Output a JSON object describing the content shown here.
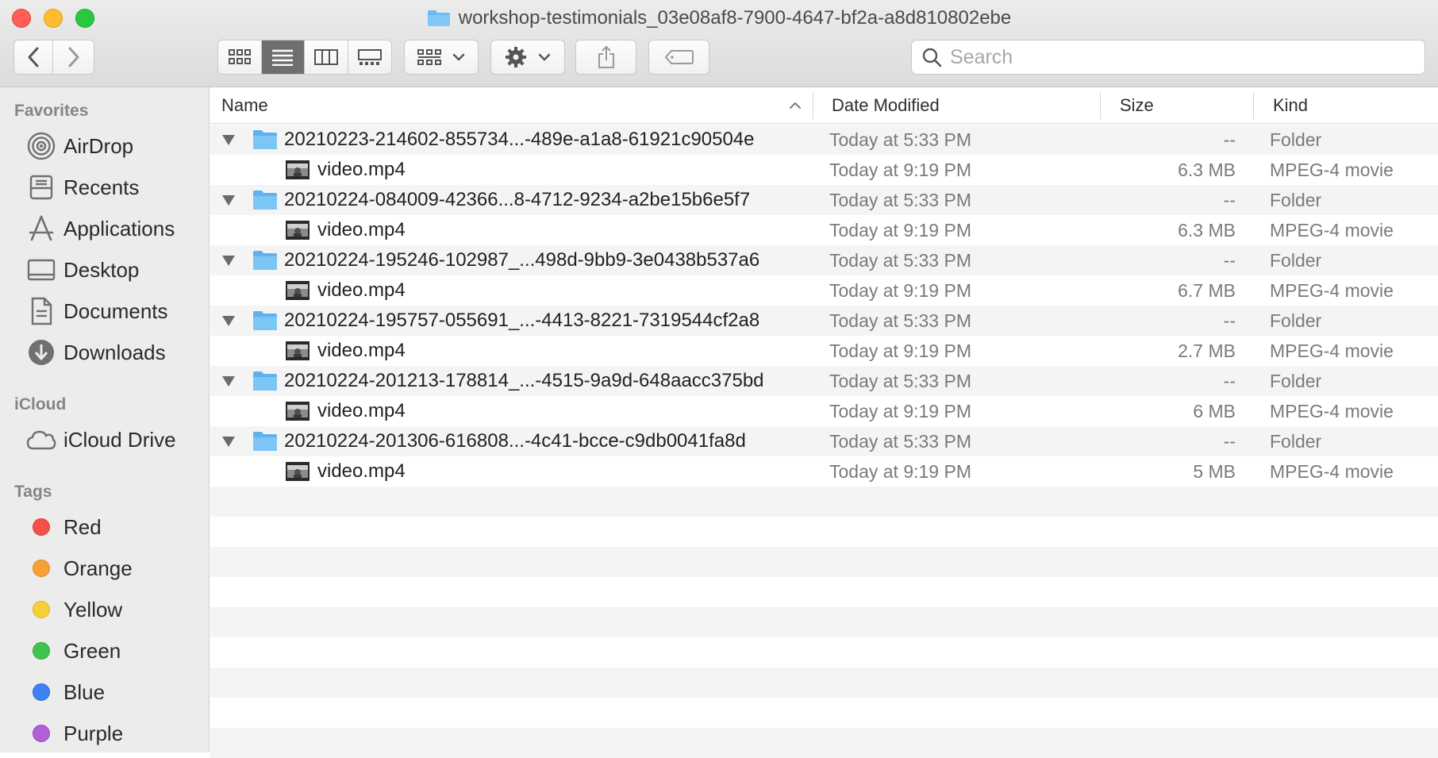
{
  "window": {
    "title": "workshop-testimonials_03e08af8-7900-4647-bf2a-a8d810802ebe",
    "folder_icon": "folder-icon"
  },
  "toolbar": {
    "back": "chevron-left-icon",
    "forward": "chevron-right-icon",
    "view_modes": [
      "icon-view",
      "list-view",
      "column-view",
      "gallery-view"
    ],
    "active_view": "list-view",
    "group_button": "group-icon",
    "action_button": "gear-icon",
    "share_button": "share-icon",
    "tag_button": "tag-icon",
    "search_placeholder": "Search"
  },
  "sidebar": {
    "favorites_heading": "Favorites",
    "favorites": [
      {
        "label": "AirDrop",
        "icon": "airdrop-icon"
      },
      {
        "label": "Recents",
        "icon": "recents-icon"
      },
      {
        "label": "Applications",
        "icon": "applications-icon"
      },
      {
        "label": "Desktop",
        "icon": "desktop-icon"
      },
      {
        "label": "Documents",
        "icon": "documents-icon"
      },
      {
        "label": "Downloads",
        "icon": "downloads-icon"
      }
    ],
    "icloud_heading": "iCloud",
    "icloud": [
      {
        "label": "iCloud Drive",
        "icon": "cloud-icon"
      }
    ],
    "tags_heading": "Tags",
    "tags": [
      {
        "label": "Red",
        "color": "#f5514a"
      },
      {
        "label": "Orange",
        "color": "#f8a035"
      },
      {
        "label": "Yellow",
        "color": "#f7cf3a"
      },
      {
        "label": "Green",
        "color": "#3fc44f"
      },
      {
        "label": "Blue",
        "color": "#3a82f6"
      },
      {
        "label": "Purple",
        "color": "#b460d9"
      }
    ]
  },
  "columns": {
    "name": "Name",
    "date": "Date Modified",
    "size": "Size",
    "kind": "Kind"
  },
  "rows": [
    {
      "type": "folder",
      "name": "20210223-214602-855734...-489e-a1a8-61921c90504e",
      "date": "Today at 5:33 PM",
      "size": "--",
      "kind": "Folder"
    },
    {
      "type": "file",
      "name": "video.mp4",
      "date": "Today at 9:19 PM",
      "size": "6.3 MB",
      "kind": "MPEG-4 movie"
    },
    {
      "type": "folder",
      "name": "20210224-084009-42366...8-4712-9234-a2be15b6e5f7",
      "date": "Today at 5:33 PM",
      "size": "--",
      "kind": "Folder"
    },
    {
      "type": "file",
      "name": "video.mp4",
      "date": "Today at 9:19 PM",
      "size": "6.3 MB",
      "kind": "MPEG-4 movie"
    },
    {
      "type": "folder",
      "name": "20210224-195246-102987_...498d-9bb9-3e0438b537a6",
      "date": "Today at 5:33 PM",
      "size": "--",
      "kind": "Folder"
    },
    {
      "type": "file",
      "name": "video.mp4",
      "date": "Today at 9:19 PM",
      "size": "6.7 MB",
      "kind": "MPEG-4 movie"
    },
    {
      "type": "folder",
      "name": "20210224-195757-055691_...-4413-8221-7319544cf2a8",
      "date": "Today at 5:33 PM",
      "size": "--",
      "kind": "Folder"
    },
    {
      "type": "file",
      "name": "video.mp4",
      "date": "Today at 9:19 PM",
      "size": "2.7 MB",
      "kind": "MPEG-4 movie"
    },
    {
      "type": "folder",
      "name": "20210224-201213-178814_...-4515-9a9d-648aacc375bd",
      "date": "Today at 5:33 PM",
      "size": "--",
      "kind": "Folder"
    },
    {
      "type": "file",
      "name": "video.mp4",
      "date": "Today at 9:19 PM",
      "size": "6 MB",
      "kind": "MPEG-4 movie"
    },
    {
      "type": "folder",
      "name": "20210224-201306-616808...-4c41-bcce-c9db0041fa8d",
      "date": "Today at 5:33 PM",
      "size": "--",
      "kind": "Folder"
    },
    {
      "type": "file",
      "name": "video.mp4",
      "date": "Today at 9:19 PM",
      "size": "5 MB",
      "kind": "MPEG-4 movie"
    }
  ],
  "colors": {
    "folder": "#6bbcf2",
    "sidebar_bg": "#ececec",
    "stripe": "#f4f4f4"
  }
}
